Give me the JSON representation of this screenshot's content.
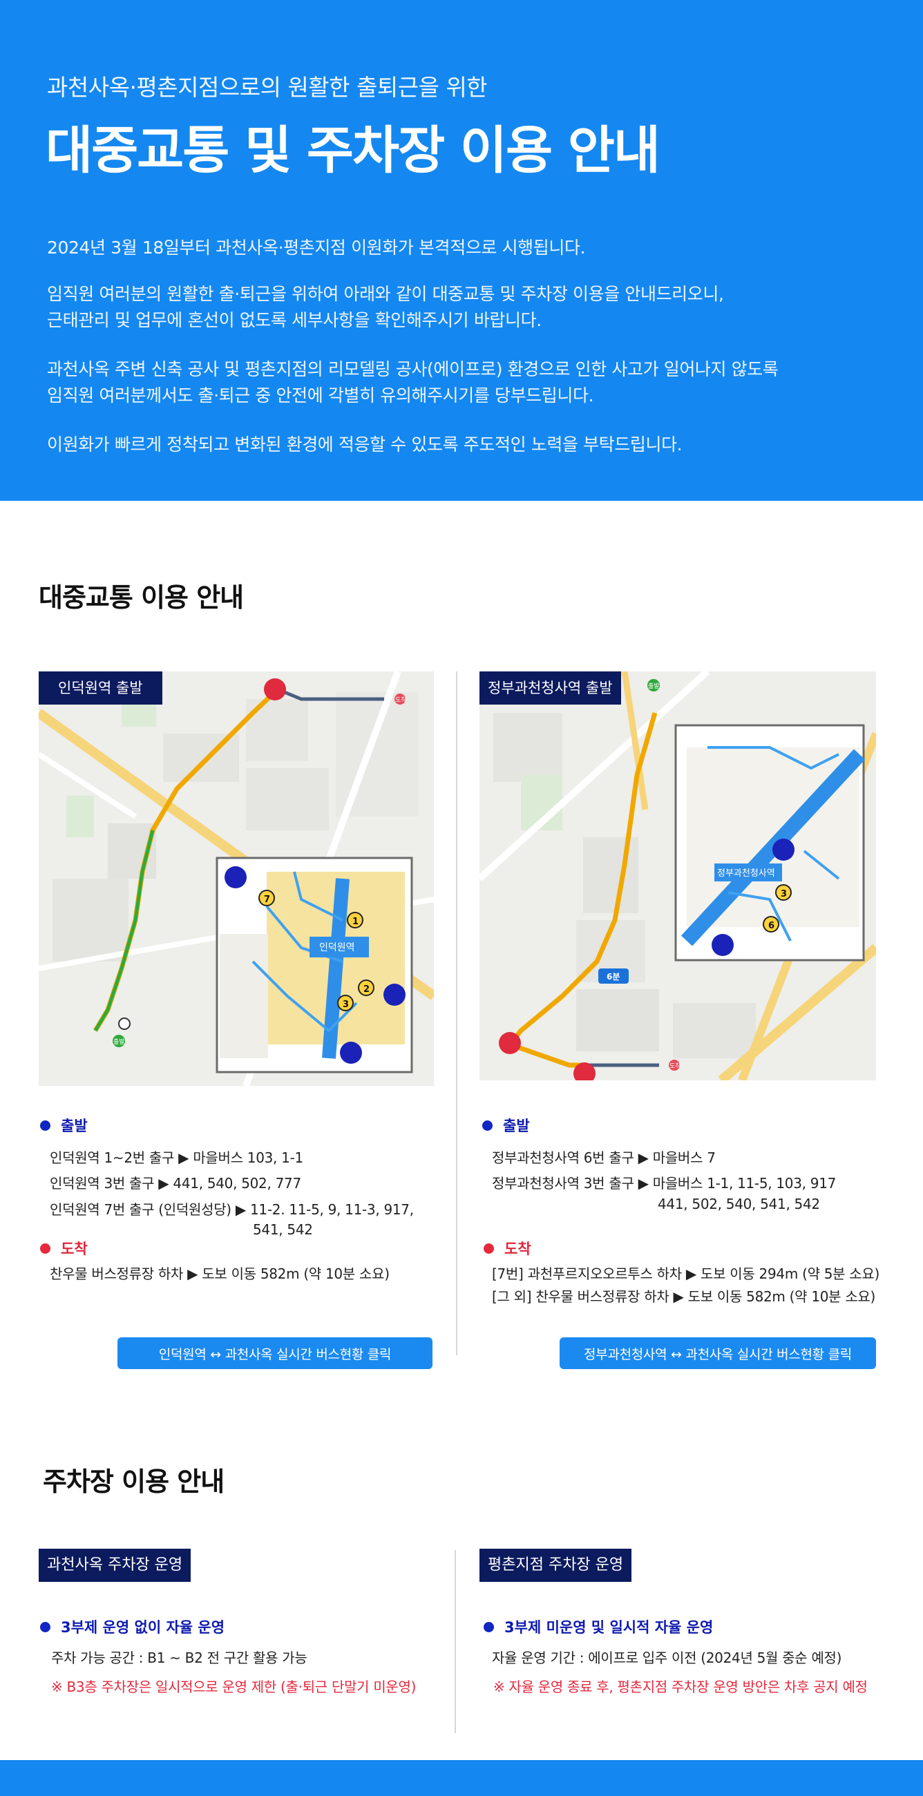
{
  "hero": {
    "subtitle": "과천사옥·평촌지점으로의 원활한 출퇴근을 위한",
    "title": "대중교통 및 주차장 이용 안내",
    "p1": "2024년 3월 18일부터 과천사옥·평촌지점 이원화가 본격적으로 시행됩니다.",
    "p2a": "임직원 여러분의 원활한 출·퇴근을 위하여 아래와 같이 대중교통 및 주차장 이용을 안내드리오니,",
    "p2b": "근태관리 및 업무에 혼선이 없도록 세부사항을 확인해주시기 바랍니다.",
    "p3a": "과천사옥 주변 신축 공사 및 평촌지점의 리모델링 공사(에이프로) 환경으로 인한 사고가 일어나지 않도록",
    "p3b": "임직원 여러분께서도 출·퇴근 중 안전에 각별히 유의해주시기를 당부드립니다.",
    "p4": "이원화가 빠르게 정착되고 변화된 환경에 적응할 수 있도록 주도적인 노력을 부탁드립니다."
  },
  "transit": {
    "section_title": "대중교통 이용 안내",
    "left": {
      "tag": "인덕원역 출발",
      "map_labels": {
        "station": "인덕원역",
        "end": "도착",
        "start": "출발",
        "exit1": "1",
        "exit2": "2",
        "exit3": "3",
        "exit7": "7"
      },
      "depart_label": "출발",
      "depart_lines": [
        "인덕원역 1~2번 출구 ▶ 마을버스 103, 1-1",
        "인덕원역 3번 출구 ▶ 441, 540, 502, 777",
        "인덕원역 7번 출구 (인덕원성당) ▶ 11-2. 11-5, 9, 11-3, 917,"
      ],
      "depart_cont": "541, 542",
      "arrive_label": "도착",
      "arrive_lines": [
        "찬우물 버스정류장 하차 ▶ 도보 이동 582m (약 10분 소요)"
      ],
      "cta": "인덕원역 ↔ 과천사옥 실시간 버스현황 클릭"
    },
    "right": {
      "tag": "정부과천청사역 출발",
      "map_labels": {
        "station": "정부과천청사역",
        "walk": "6분",
        "end": "도착",
        "start": "출발",
        "exit3": "3",
        "exit6": "6"
      },
      "depart_label": "출발",
      "depart_lines": [
        "정부과천청사역 6번 출구 ▶ 마을버스 7",
        "정부과천청사역 3번 출구 ▶ 마을버스 1-1, 11-5, 103, 917"
      ],
      "depart_cont": "441, 502, 540, 541, 542",
      "arrive_label": "도착",
      "arrive_lines": [
        "[7번] 과천푸르지오오르투스 하차 ▶ 도보 이동 294m (약 5분 소요)",
        "[그 외] 찬우물 버스정류장 하차 ▶ 도보 이동 582m (약 10분 소요)"
      ],
      "cta": "정부과천청사역 ↔ 과천사옥 실시간 버스현황 클릭"
    }
  },
  "parking": {
    "section_title": "주차장 이용 안내",
    "left": {
      "tag": "과천사옥 주차장 운영",
      "heading": "3부제 운영 없이 자율 운영",
      "line": "주차 가능 공간 : B1 ~ B2 전 구간 활용 가능",
      "note": "※ B3층 주차장은 일시적으로 운영 제한 (출·퇴근 단말기 미운영)"
    },
    "right": {
      "tag": "평촌지점 주차장 운영",
      "heading": "3부제 미운영 및 일시적 자율 운영",
      "line": "자율 운영 기간 : 에이프로 입주 이전 (2024년 5월 중순 예정)",
      "note": "※ 자율 운영 종료 후, 평촌지점 주차장 운영 방안은 차후 공지 예정"
    }
  },
  "colors": {
    "brand_blue": "#1488f0",
    "navy": "#0c1a5e",
    "bullet_blue": "#1226c4",
    "alert_red": "#e5283c"
  }
}
